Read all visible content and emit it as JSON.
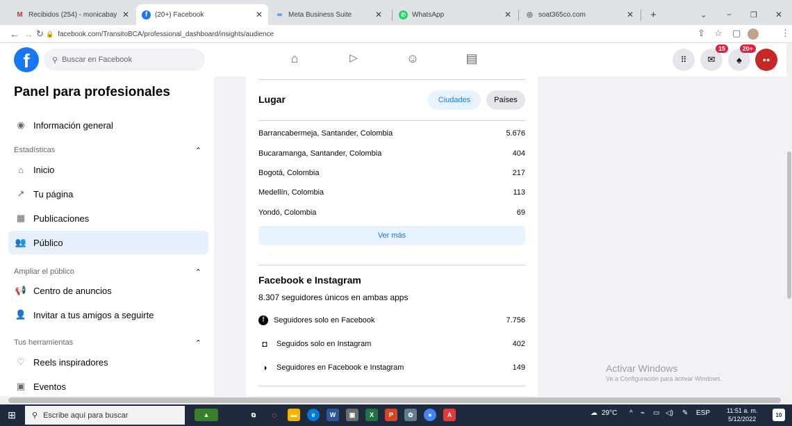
{
  "browser": {
    "tabs": [
      {
        "label": "Recibidos (254) - monicabay",
        "icon": "gmail-icon"
      },
      {
        "label": "(20+) Facebook",
        "icon": "facebook-icon",
        "active": true
      },
      {
        "label": "Meta Business Suite",
        "icon": "meta-icon"
      },
      {
        "label": "WhatsApp",
        "icon": "whatsapp-icon"
      },
      {
        "label": "soat365co.com",
        "icon": "globe-icon"
      }
    ],
    "url": "facebook.com/TransitoBCA/professional_dashboard/insights/audience"
  },
  "fb_header": {
    "search_placeholder": "Buscar en Facebook",
    "messenger_badge": "15",
    "notifications_badge": "20+"
  },
  "sidebar": {
    "title": "Panel para profesionales",
    "overview": "Información general",
    "sections": [
      {
        "heading": "Estadísticas",
        "items": [
          "Inicio",
          "Tu página",
          "Publicaciones",
          "Público"
        ]
      },
      {
        "heading": "Ampliar el público",
        "items": [
          "Centro de anuncios",
          "Invitar a tus amigos a seguirte"
        ]
      },
      {
        "heading": "Tus herramientas",
        "items": [
          "Reels inspiradores",
          "Eventos"
        ]
      }
    ]
  },
  "lugar": {
    "title": "Lugar",
    "tab_cities": "Ciudades",
    "tab_countries": "Países",
    "rows": [
      {
        "place": "Barrancabermeja, Santander, Colombia",
        "value": "5.676"
      },
      {
        "place": "Bucaramanga, Santander, Colombia",
        "value": "404"
      },
      {
        "place": "Bogotá, Colombia",
        "value": "217"
      },
      {
        "place": "Medellín, Colombia",
        "value": "113"
      },
      {
        "place": "Yondó, Colombia",
        "value": "69"
      }
    ],
    "see_more": "Ver más"
  },
  "fb_ig": {
    "title": "Facebook e Instagram",
    "unique": "8.307 seguidores únicos en ambas apps",
    "rows": [
      {
        "label": "Seguidores solo en Facebook",
        "value": "7.756"
      },
      {
        "label": "Seguidos solo en Instagram",
        "value": "402"
      },
      {
        "label": "Seguidores en Facebook e Instagram",
        "value": "149"
      }
    ]
  },
  "windows": {
    "activate_title": "Activar Windows",
    "activate_sub": "Ve a Configuración para activar Windows.",
    "taskbar_search": "Escribe aquí para buscar",
    "temperature": "29°C",
    "language": "ESP",
    "time": "11:51 a. m.",
    "date": "5/12/2022",
    "notif_count": "10"
  },
  "colors": {
    "fb_blue": "#1877f2",
    "badge_red": "#e41e3f",
    "active_bg": "#e7f0fd"
  }
}
